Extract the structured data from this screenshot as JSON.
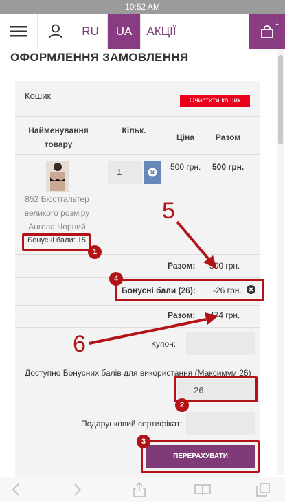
{
  "status_bar": {
    "time": "10:52 AM"
  },
  "nav": {
    "lang_ru": "RU",
    "lang_ua": "UA",
    "promo": "АКЦІЇ",
    "cart_count": "1"
  },
  "page": {
    "title": "ОФОРМЛЕННЯ ЗАМОВЛЕННЯ"
  },
  "cart": {
    "title": "Кошик",
    "clear_label": "Очистити кошик",
    "headers": {
      "name": "Найменування товару",
      "qty": "Кільк.",
      "price": "Ціна",
      "total": "Разом"
    },
    "item": {
      "name": "852 Бюстгальтер великого розміру Ангела Чорний",
      "bonus_points": "Бонусні бали: 15",
      "qty": "1",
      "price": "500 грн.",
      "total": "500 грн."
    },
    "subtotal_label": "Разом:",
    "subtotal_value": "500 грн.",
    "bonus_label": "Бонусні бали (26):",
    "bonus_value": "-26 грн.",
    "grand_total_label": "Разом:",
    "grand_total_value": "474 грн.",
    "coupon_label": "Купон:",
    "bonus_available_label": "Доступно Бонусних балів для використання (Максимум 26)",
    "bonus_input_value": "26",
    "gift_label": "Подарунковий сертифікат:",
    "recalc_label": "ПЕРЕРАХУВАТИ"
  },
  "annotations": {
    "n1": "1",
    "n2": "2",
    "n3": "3",
    "n4": "4",
    "n5": "5",
    "n6": "6"
  },
  "colors": {
    "brand": "#8a3c82",
    "clear": "#e8001c",
    "annotation": "#b31217"
  }
}
